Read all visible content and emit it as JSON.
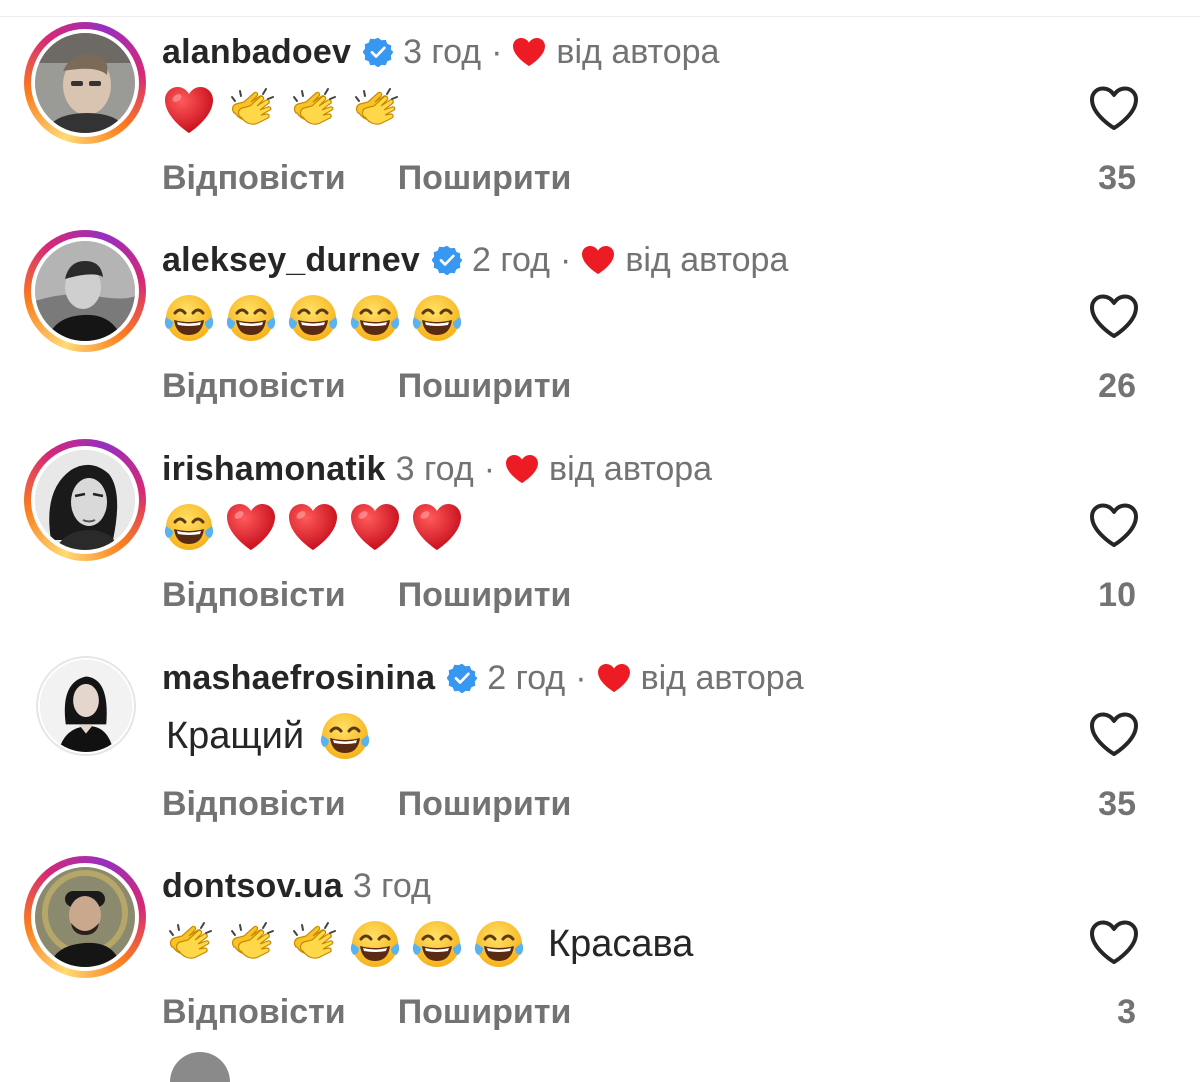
{
  "colors": {
    "text": "#262626",
    "muted": "#737373",
    "verified_blue": "#3897f0",
    "heart_red": "#ed1c24"
  },
  "labels": {
    "reply": "Відповісти",
    "share": "Поширити",
    "by_author": "від автора",
    "dot": "·"
  },
  "comments": [
    {
      "username": "alanbadoev",
      "verified": true,
      "time": "3 год",
      "liked_by_author": true,
      "body_emojis": [
        "red-heart",
        "clapping-hands",
        "clapping-hands",
        "clapping-hands"
      ],
      "text_before": "",
      "text_after": "",
      "likes": "35",
      "avatar_ring": "story"
    },
    {
      "username": "aleksey_durnev",
      "verified": true,
      "time": "2 год",
      "liked_by_author": true,
      "body_emojis": [
        "tears-of-joy",
        "tears-of-joy",
        "tears-of-joy",
        "tears-of-joy",
        "tears-of-joy"
      ],
      "text_before": "",
      "text_after": "",
      "likes": "26",
      "avatar_ring": "story"
    },
    {
      "username": "irishamonatik",
      "verified": false,
      "time": "3 год",
      "liked_by_author": true,
      "body_emojis": [
        "tears-of-joy",
        "red-heart",
        "red-heart",
        "red-heart",
        "red-heart"
      ],
      "text_before": "",
      "text_after": "",
      "likes": "10",
      "avatar_ring": "story"
    },
    {
      "username": "mashaefrosinina",
      "verified": true,
      "time": "2 год",
      "liked_by_author": true,
      "body_emojis": [
        "tears-of-joy"
      ],
      "text_before": "Кращий",
      "text_after": "",
      "likes": "35",
      "avatar_ring": "plain"
    },
    {
      "username": "dontsov.ua",
      "verified": false,
      "time": "3 год",
      "liked_by_author": false,
      "body_emojis": [
        "clapping-hands",
        "clapping-hands",
        "clapping-hands",
        "tears-of-joy",
        "tears-of-joy",
        "tears-of-joy"
      ],
      "text_before": "",
      "text_after": "Красава",
      "likes": "3",
      "avatar_ring": "story"
    }
  ]
}
